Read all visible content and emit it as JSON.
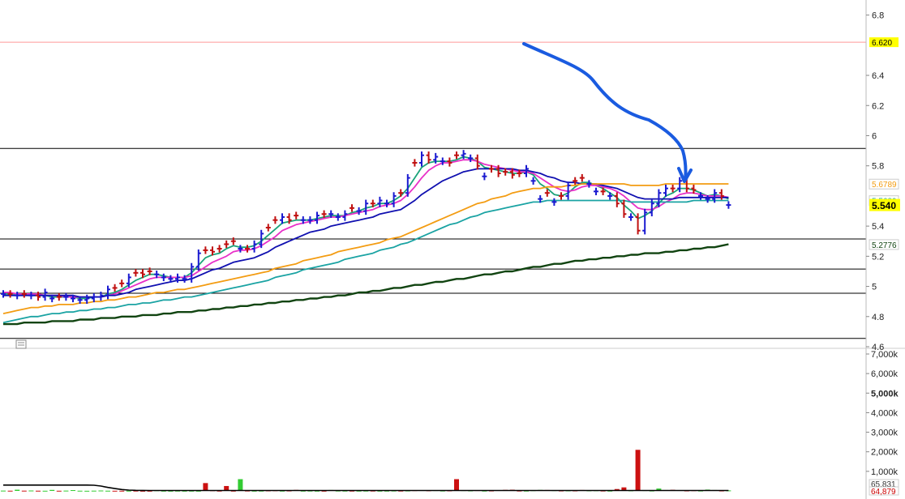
{
  "chart_data": {
    "type": "line",
    "price_axis": {
      "ylim": [
        4.6,
        6.9
      ],
      "ticks": [
        "6.8",
        "6.4",
        "6.2",
        "6",
        "5.8",
        "5.4",
        "5.2",
        "5",
        "4.8",
        "4.6"
      ],
      "tick_values": [
        6.8,
        6.4,
        6.2,
        6.0,
        5.8,
        5.4,
        5.2,
        5.0,
        4.8,
        4.6
      ]
    },
    "volume_axis": {
      "ylim": [
        0,
        7000
      ],
      "ticks": [
        "7,000k",
        "6,000k",
        "5,000k",
        "4,000k",
        "3,000k",
        "2,000k",
        "1,000k"
      ],
      "tick_values": [
        7000,
        6000,
        5000,
        4000,
        3000,
        2000,
        1000
      ],
      "bold_tick": "5,000k"
    },
    "reference_line": {
      "value": 6.62,
      "label": "6.620",
      "color": "#ff9999",
      "tag_color": "#ffff00"
    },
    "horizontal_lines": [
      5.915,
      5.315,
      5.115,
      4.955,
      4.655
    ],
    "value_tags": [
      {
        "label": "6.620",
        "value": 6.62,
        "bg": "#ffff00",
        "fg": "#000000"
      },
      {
        "label": "5.6789",
        "value": 5.6789,
        "bg": "#ffffff",
        "fg": "#f39c12"
      },
      {
        "label": "5.5689",
        "value": 5.5689,
        "bg": "#ffffff",
        "fg": "#1aa3a3"
      },
      {
        "label": "5.540",
        "value": 5.54,
        "bg": "#ffff00",
        "fg": "#000000",
        "big": true
      },
      {
        "label": "5.2776",
        "value": 5.2776,
        "bg": "#ffffff",
        "fg": "#114411"
      }
    ],
    "volume_tags": [
      {
        "label": "65,831",
        "value": 65.8,
        "fg": "#333333"
      },
      {
        "label": "64,879",
        "value": 0,
        "fg": "#cc0000"
      }
    ],
    "bars_close": [
      4.95,
      4.95,
      4.94,
      4.95,
      4.94,
      4.93,
      4.96,
      4.92,
      4.93,
      4.93,
      4.92,
      4.91,
      4.92,
      4.93,
      4.94,
      4.98,
      4.99,
      5.02,
      5.06,
      5.09,
      5.08,
      5.1,
      5.08,
      5.06,
      5.05,
      5.06,
      5.05,
      5.13,
      5.22,
      5.24,
      5.23,
      5.25,
      5.28,
      5.3,
      5.25,
      5.25,
      5.28,
      5.35,
      5.39,
      5.44,
      5.46,
      5.44,
      5.47,
      5.44,
      5.44,
      5.47,
      5.48,
      5.48,
      5.46,
      5.48,
      5.52,
      5.5,
      5.55,
      5.55,
      5.57,
      5.55,
      5.6,
      5.62,
      5.72,
      5.82,
      5.87,
      5.84,
      5.86,
      5.83,
      5.82,
      5.87,
      5.88,
      5.85,
      5.8,
      5.73,
      5.78,
      5.75,
      5.76,
      5.74,
      5.75,
      5.78,
      5.7,
      5.58,
      5.62,
      5.56,
      5.6,
      5.67,
      5.7,
      5.72,
      5.68,
      5.63,
      5.63,
      5.6,
      5.55,
      5.48,
      5.46,
      5.37,
      5.49,
      5.55,
      5.62,
      5.65,
      5.65,
      5.7,
      5.65,
      5.64,
      5.6,
      5.58,
      5.62,
      5.6,
      5.54
    ],
    "bars_up": [
      true,
      false,
      true,
      false,
      true,
      false,
      true,
      true,
      false,
      true,
      true,
      true,
      true,
      true,
      true,
      true,
      false,
      false,
      true,
      false,
      false,
      false,
      true,
      true,
      true,
      true,
      true,
      true,
      true,
      false,
      false,
      false,
      false,
      false,
      true,
      false,
      true,
      true,
      false,
      false,
      true,
      false,
      false,
      true,
      true,
      true,
      false,
      true,
      true,
      true,
      false,
      true,
      true,
      false,
      true,
      true,
      true,
      false,
      true,
      false,
      true,
      false,
      true,
      true,
      false,
      false,
      true,
      true,
      false,
      true,
      false,
      false,
      false,
      false,
      false,
      true,
      true,
      true,
      false,
      true,
      false,
      true,
      false,
      false,
      true,
      true,
      false,
      true,
      false,
      false,
      true,
      false,
      true,
      true,
      true,
      true,
      false,
      true,
      false,
      false,
      true,
      true,
      true,
      false,
      true
    ],
    "series": [
      {
        "color": "#1aa37a",
        "values": [
          4.95,
          4.95,
          4.95,
          4.95,
          4.94,
          4.94,
          4.94,
          4.93,
          4.93,
          4.93,
          4.93,
          4.92,
          4.92,
          4.93,
          4.93,
          4.95,
          4.96,
          4.98,
          5.01,
          5.04,
          5.06,
          5.08,
          5.08,
          5.07,
          5.06,
          5.06,
          5.06,
          5.09,
          5.14,
          5.19,
          5.21,
          5.22,
          5.25,
          5.27,
          5.26,
          5.26,
          5.27,
          5.3,
          5.34,
          5.38,
          5.42,
          5.43,
          5.44,
          5.44,
          5.44,
          5.45,
          5.46,
          5.47,
          5.47,
          5.47,
          5.49,
          5.5,
          5.52,
          5.53,
          5.55,
          5.55,
          5.57,
          5.6,
          5.65,
          5.72,
          5.79,
          5.82,
          5.83,
          5.83,
          5.83,
          5.84,
          5.86,
          5.85,
          5.83,
          5.79,
          5.78,
          5.77,
          5.76,
          5.75,
          5.75,
          5.76,
          5.74,
          5.68,
          5.65,
          5.61,
          5.6,
          5.62,
          5.66,
          5.69,
          5.69,
          5.67,
          5.65,
          5.62,
          5.59,
          5.54,
          5.5,
          5.45,
          5.47,
          5.5,
          5.55,
          5.6,
          5.62,
          5.65,
          5.65,
          5.64,
          5.62,
          5.6,
          5.61,
          5.6,
          5.58
        ]
      },
      {
        "color": "#e830c8",
        "values": [
          4.96,
          4.96,
          4.95,
          4.95,
          4.95,
          4.95,
          4.94,
          4.94,
          4.94,
          4.93,
          4.93,
          4.93,
          4.93,
          4.93,
          4.93,
          4.94,
          4.95,
          4.97,
          4.99,
          5.01,
          5.03,
          5.05,
          5.06,
          5.06,
          5.06,
          5.06,
          5.06,
          5.07,
          5.1,
          5.13,
          5.16,
          5.18,
          5.2,
          5.23,
          5.24,
          5.24,
          5.25,
          5.27,
          5.3,
          5.33,
          5.37,
          5.39,
          5.41,
          5.42,
          5.43,
          5.44,
          5.45,
          5.46,
          5.46,
          5.47,
          5.48,
          5.49,
          5.5,
          5.51,
          5.53,
          5.54,
          5.55,
          5.57,
          5.61,
          5.66,
          5.72,
          5.77,
          5.8,
          5.82,
          5.82,
          5.83,
          5.84,
          5.84,
          5.83,
          5.81,
          5.8,
          5.79,
          5.78,
          5.77,
          5.76,
          5.76,
          5.75,
          5.72,
          5.69,
          5.66,
          5.64,
          5.63,
          5.64,
          5.66,
          5.67,
          5.67,
          5.66,
          5.65,
          5.63,
          5.6,
          5.56,
          5.52,
          5.51,
          5.51,
          5.53,
          5.56,
          5.58,
          5.61,
          5.62,
          5.62,
          5.61,
          5.6,
          5.6,
          5.6,
          5.59
        ]
      },
      {
        "color": "#1010b0",
        "values": [
          4.94,
          4.94,
          4.94,
          4.94,
          4.94,
          4.94,
          4.94,
          4.94,
          4.94,
          4.94,
          4.94,
          4.93,
          4.93,
          4.93,
          4.93,
          4.94,
          4.94,
          4.95,
          4.96,
          4.98,
          4.99,
          5.0,
          5.01,
          5.02,
          5.03,
          5.04,
          5.04,
          5.05,
          5.07,
          5.09,
          5.11,
          5.12,
          5.14,
          5.16,
          5.17,
          5.18,
          5.19,
          5.21,
          5.23,
          5.26,
          5.28,
          5.3,
          5.32,
          5.34,
          5.36,
          5.37,
          5.38,
          5.4,
          5.41,
          5.42,
          5.43,
          5.44,
          5.45,
          5.46,
          5.48,
          5.49,
          5.5,
          5.51,
          5.54,
          5.57,
          5.61,
          5.64,
          5.67,
          5.7,
          5.72,
          5.74,
          5.76,
          5.77,
          5.78,
          5.78,
          5.78,
          5.78,
          5.78,
          5.78,
          5.77,
          5.77,
          5.76,
          5.75,
          5.73,
          5.72,
          5.7,
          5.69,
          5.69,
          5.68,
          5.68,
          5.68,
          5.67,
          5.66,
          5.65,
          5.63,
          5.61,
          5.59,
          5.58,
          5.58,
          5.58,
          5.58,
          5.58,
          5.59,
          5.59,
          5.59,
          5.59,
          5.59,
          5.59,
          5.59,
          5.59
        ]
      },
      {
        "color": "#f39c12",
        "values": [
          4.82,
          4.83,
          4.84,
          4.85,
          4.86,
          4.86,
          4.87,
          4.87,
          4.88,
          4.88,
          4.88,
          4.89,
          4.89,
          4.9,
          4.9,
          4.91,
          4.91,
          4.92,
          4.93,
          4.93,
          4.94,
          4.95,
          4.96,
          4.96,
          4.97,
          4.98,
          4.98,
          4.99,
          5.0,
          5.01,
          5.02,
          5.03,
          5.04,
          5.05,
          5.06,
          5.07,
          5.08,
          5.09,
          5.1,
          5.12,
          5.13,
          5.14,
          5.15,
          5.17,
          5.18,
          5.19,
          5.2,
          5.21,
          5.23,
          5.24,
          5.25,
          5.26,
          5.27,
          5.28,
          5.29,
          5.31,
          5.32,
          5.33,
          5.35,
          5.37,
          5.39,
          5.41,
          5.43,
          5.45,
          5.47,
          5.49,
          5.51,
          5.53,
          5.55,
          5.56,
          5.58,
          5.59,
          5.6,
          5.62,
          5.63,
          5.64,
          5.65,
          5.65,
          5.66,
          5.66,
          5.66,
          5.67,
          5.67,
          5.68,
          5.68,
          5.68,
          5.68,
          5.68,
          5.68,
          5.68,
          5.67,
          5.67,
          5.67,
          5.67,
          5.67,
          5.68,
          5.68,
          5.68,
          5.68,
          5.68,
          5.68,
          5.68,
          5.68,
          5.68,
          5.68
        ]
      },
      {
        "color": "#1aa3a3",
        "values": [
          4.76,
          4.77,
          4.78,
          4.79,
          4.8,
          4.8,
          4.81,
          4.82,
          4.82,
          4.83,
          4.83,
          4.84,
          4.84,
          4.85,
          4.85,
          4.86,
          4.86,
          4.87,
          4.88,
          4.88,
          4.89,
          4.89,
          4.9,
          4.91,
          4.91,
          4.92,
          4.93,
          4.93,
          4.94,
          4.95,
          4.96,
          4.97,
          4.98,
          4.99,
          5.0,
          5.01,
          5.02,
          5.03,
          5.04,
          5.06,
          5.07,
          5.08,
          5.09,
          5.11,
          5.12,
          5.13,
          5.14,
          5.15,
          5.16,
          5.18,
          5.19,
          5.2,
          5.21,
          5.22,
          5.24,
          5.25,
          5.26,
          5.28,
          5.29,
          5.31,
          5.33,
          5.35,
          5.37,
          5.39,
          5.41,
          5.42,
          5.44,
          5.46,
          5.47,
          5.49,
          5.5,
          5.51,
          5.52,
          5.53,
          5.54,
          5.55,
          5.56,
          5.56,
          5.57,
          5.57,
          5.57,
          5.57,
          5.57,
          5.57,
          5.57,
          5.57,
          5.57,
          5.57,
          5.57,
          5.57,
          5.56,
          5.56,
          5.56,
          5.56,
          5.56,
          5.56,
          5.56,
          5.56,
          5.56,
          5.57,
          5.57,
          5.57,
          5.57,
          5.57,
          5.57
        ]
      },
      {
        "color": "#114411",
        "width": 2.4,
        "values": [
          4.75,
          4.75,
          4.75,
          4.76,
          4.76,
          4.76,
          4.76,
          4.77,
          4.77,
          4.77,
          4.77,
          4.78,
          4.78,
          4.78,
          4.79,
          4.79,
          4.79,
          4.8,
          4.8,
          4.8,
          4.81,
          4.81,
          4.81,
          4.82,
          4.82,
          4.83,
          4.83,
          4.83,
          4.84,
          4.84,
          4.85,
          4.85,
          4.86,
          4.86,
          4.87,
          4.87,
          4.88,
          4.88,
          4.89,
          4.89,
          4.9,
          4.9,
          4.91,
          4.91,
          4.92,
          4.92,
          4.93,
          4.93,
          4.94,
          4.94,
          4.95,
          4.96,
          4.96,
          4.97,
          4.97,
          4.98,
          4.99,
          4.99,
          5.0,
          5.01,
          5.01,
          5.02,
          5.03,
          5.03,
          5.04,
          5.05,
          5.05,
          5.06,
          5.07,
          5.08,
          5.08,
          5.09,
          5.1,
          5.1,
          5.11,
          5.12,
          5.13,
          5.13,
          5.14,
          5.15,
          5.15,
          5.16,
          5.17,
          5.17,
          5.18,
          5.18,
          5.19,
          5.19,
          5.2,
          5.2,
          5.21,
          5.21,
          5.22,
          5.22,
          5.22,
          5.23,
          5.23,
          5.24,
          5.24,
          5.25,
          5.25,
          5.26,
          5.26,
          5.27,
          5.28
        ]
      }
    ],
    "volume": [
      15,
      10,
      60,
      12,
      20,
      10,
      8,
      50,
      8,
      15,
      40,
      10,
      6,
      12,
      20,
      10,
      8,
      9,
      10,
      12,
      5,
      6,
      30,
      8,
      5,
      10,
      7,
      8,
      6,
      400,
      30,
      10,
      250,
      9,
      600,
      15,
      8,
      10,
      22,
      30,
      10,
      18,
      50,
      9,
      12,
      8,
      7,
      45,
      14,
      11,
      10,
      9,
      12,
      13,
      8,
      10,
      15,
      12,
      18,
      35,
      40,
      28,
      38,
      15,
      22,
      600,
      36,
      20,
      38,
      12,
      18,
      40,
      52,
      60,
      14,
      12,
      33,
      50,
      45,
      35,
      18,
      22,
      20,
      45,
      25,
      30,
      15,
      10,
      95,
      180,
      24,
      2100,
      38,
      16,
      120,
      44,
      55,
      40,
      20,
      32,
      15,
      66,
      44,
      18,
      25
    ],
    "volume_up": [
      true,
      false,
      true,
      false,
      true,
      false,
      true,
      true,
      false,
      true,
      true,
      true,
      true,
      true,
      true,
      true,
      false,
      false,
      true,
      false,
      false,
      false,
      true,
      true,
      true,
      true,
      true,
      true,
      true,
      false,
      false,
      false,
      false,
      false,
      true,
      false,
      true,
      true,
      false,
      false,
      true,
      false,
      false,
      true,
      true,
      true,
      false,
      true,
      true,
      true,
      false,
      true,
      true,
      false,
      true,
      true,
      true,
      false,
      true,
      false,
      true,
      false,
      true,
      true,
      false,
      false,
      true,
      true,
      false,
      true,
      false,
      false,
      false,
      false,
      false,
      true,
      true,
      true,
      false,
      true,
      false,
      true,
      false,
      false,
      true,
      true,
      false,
      true,
      false,
      false,
      true,
      false,
      true,
      true,
      true,
      true,
      false,
      true,
      false,
      false,
      true,
      true,
      true,
      false,
      true
    ],
    "volume_avg": [
      300,
      300,
      300,
      300,
      300,
      300,
      300,
      300,
      300,
      300,
      300,
      300,
      300,
      290,
      250,
      180,
      120,
      70,
      40,
      30,
      25,
      22,
      20,
      20,
      20,
      20,
      20,
      20,
      20,
      20,
      20,
      20,
      20,
      20,
      20,
      20,
      20,
      20,
      20,
      20,
      20,
      20,
      20,
      20,
      20,
      20,
      20,
      20,
      20,
      20,
      20,
      20,
      20,
      20,
      20,
      20,
      20,
      20,
      20,
      20,
      20,
      20,
      20,
      20,
      20,
      20,
      20,
      20,
      20,
      20,
      20,
      20,
      20,
      20,
      20,
      20,
      20,
      20,
      20,
      20,
      20,
      20,
      20,
      20,
      20,
      20,
      20,
      20,
      20,
      20,
      20,
      20,
      20,
      20,
      20,
      20,
      20,
      20,
      20,
      20,
      20,
      20,
      20,
      20,
      20
    ]
  }
}
